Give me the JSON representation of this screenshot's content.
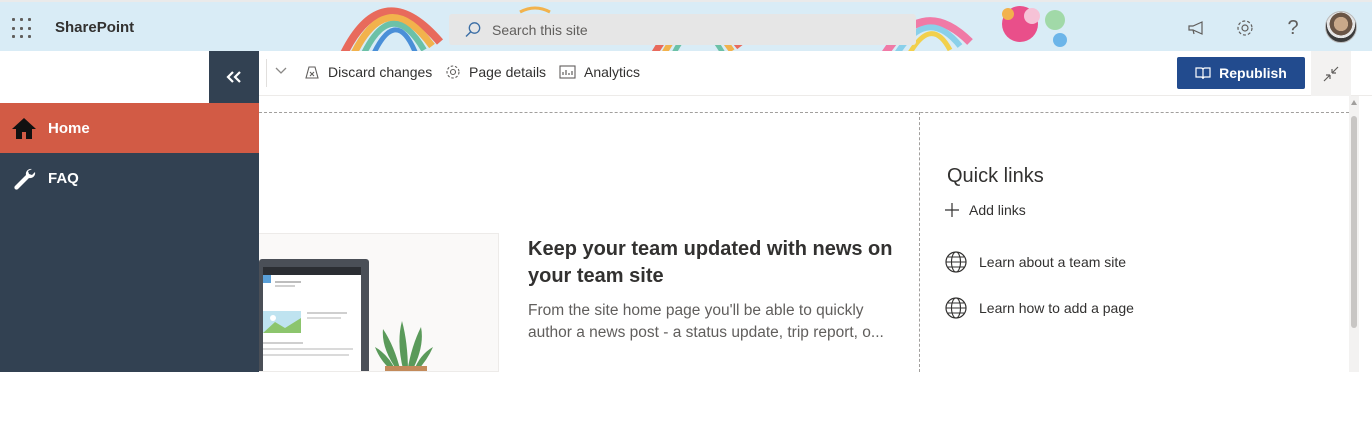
{
  "suitebar": {
    "brand": "SharePoint",
    "search_placeholder": "Search this site",
    "icons": [
      "waffle-icon",
      "megaphone-icon",
      "gear-icon",
      "help-icon",
      "avatar"
    ]
  },
  "commandbar": {
    "discard_label": "Discard changes",
    "page_details_label": "Page details",
    "analytics_label": "Analytics",
    "republish_label": "Republish",
    "accent": "#224b8e"
  },
  "leftnav": {
    "items": [
      {
        "label": "Home",
        "icon": "home-icon",
        "active": true
      },
      {
        "label": "FAQ",
        "icon": "wrench-icon",
        "active": false
      }
    ],
    "active_color": "#d25b45",
    "bg_color": "#324152"
  },
  "news": {
    "title": "Keep your team updated with news on your team site",
    "description": "From the site home page you'll be able to quickly author a news post - a status update, trip report, o..."
  },
  "quicklinks": {
    "title": "Quick links",
    "add_label": "Add links",
    "links": [
      {
        "label": "Learn about a team site",
        "icon": "globe-icon"
      },
      {
        "label": "Learn how to add a page",
        "icon": "globe-icon"
      }
    ]
  }
}
